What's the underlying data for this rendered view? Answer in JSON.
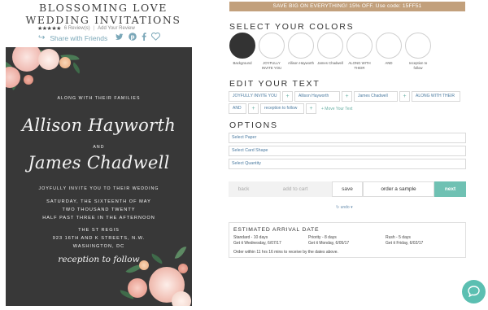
{
  "product": {
    "title": "BLOSSOMING LOVE WEDDING INVITATIONS",
    "stars": "★★★★★",
    "reviews": "6 Review(s)",
    "separator": "|",
    "add_review": "Add Your Review",
    "share_label": "Share with Friends"
  },
  "card": {
    "top_line": "ALONG WITH THEIR FAMILIES",
    "name1": "Allison Hayworth",
    "and": "AND",
    "name2": "James Chadwell",
    "invite_line": "JOYFULLY INVITE YOU TO THEIR WEDDING",
    "date1": "SATURDAY, THE SIXTEENTH OF MAY",
    "date2": "TWO THOUSAND TWENTY",
    "date3": "HALF PAST THREE IN THE AFTERNOON",
    "venue1": "THE ST REGIS",
    "venue2": "923 16TH AND K STREETS, N.W.",
    "venue3": "WASHINGTON, DC",
    "reception": "reception to follow",
    "colors": {
      "background": "#383838",
      "text": "#f4f4f4"
    }
  },
  "promo": {
    "text": "SAVE BIG ON EVERYTHING! 15% OFF. Use code: 15FF51"
  },
  "colors_section": {
    "title": "SELECT YOUR COLORS",
    "swatches": [
      {
        "label": "Background",
        "selected": true,
        "color": "#333333"
      },
      {
        "label": "JOYFULLY INVITE YOU",
        "color": "#ffffff"
      },
      {
        "label": "Allison Hayworth",
        "color": "#ffffff"
      },
      {
        "label": "James Chadwell",
        "color": "#ffffff"
      },
      {
        "label": "ALONG WITH THEIR",
        "color": "#ffffff"
      },
      {
        "label": "AND",
        "color": "#ffffff"
      },
      {
        "label": "reception to follow",
        "color": "#ffffff"
      }
    ]
  },
  "edit_text": {
    "title": "EDIT YOUR TEXT",
    "row1": [
      "JOYFULLY INVITE YOU",
      "Allison Hayworth",
      "James Chadwell",
      "ALONG WITH THEIR"
    ],
    "row2": [
      "AND",
      "reception to follow"
    ],
    "plus": "+",
    "move_text": "+ Move Your Text"
  },
  "options": {
    "title": "OPTIONS",
    "paper": "Select Paper",
    "card_shape": "Select Card Shape",
    "quantity": "Select Quantity"
  },
  "actions": {
    "back": "back",
    "add_to_cart": "add to cart",
    "save": "save",
    "order_sample": "order a sample",
    "next": "next",
    "undo": "↻ undo ▾"
  },
  "arrival": {
    "title": "ESTIMATED ARRIVAL DATE",
    "standard": "Standard - 10 days",
    "standard_date": "Get it Wednesday, 6/07/17",
    "priority": "Priority - 8 days",
    "priority_date": "Get it Monday, 6/05/17",
    "rush": "Rush - 5 days",
    "rush_date": "Get it Friday, 6/02/17",
    "note": "Order within 11 hrs 16 mins to receive by the dates above."
  },
  "chat": {
    "icon": "chat-bubble-icon"
  },
  "theme": {
    "accent": "#6fc1b3",
    "promo": "#c2a07c",
    "link": "#4a7aa0"
  }
}
